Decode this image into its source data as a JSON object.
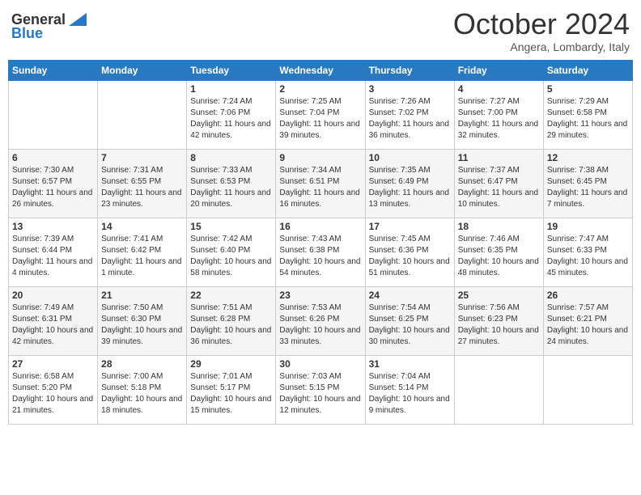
{
  "header": {
    "logo_general": "General",
    "logo_blue": "Blue",
    "month_title": "October 2024",
    "location": "Angera, Lombardy, Italy"
  },
  "days_of_week": [
    "Sunday",
    "Monday",
    "Tuesday",
    "Wednesday",
    "Thursday",
    "Friday",
    "Saturday"
  ],
  "weeks": [
    [
      {
        "day": "",
        "info": ""
      },
      {
        "day": "",
        "info": ""
      },
      {
        "day": "1",
        "info": "Sunrise: 7:24 AM\nSunset: 7:06 PM\nDaylight: 11 hours and 42 minutes."
      },
      {
        "day": "2",
        "info": "Sunrise: 7:25 AM\nSunset: 7:04 PM\nDaylight: 11 hours and 39 minutes."
      },
      {
        "day": "3",
        "info": "Sunrise: 7:26 AM\nSunset: 7:02 PM\nDaylight: 11 hours and 36 minutes."
      },
      {
        "day": "4",
        "info": "Sunrise: 7:27 AM\nSunset: 7:00 PM\nDaylight: 11 hours and 32 minutes."
      },
      {
        "day": "5",
        "info": "Sunrise: 7:29 AM\nSunset: 6:58 PM\nDaylight: 11 hours and 29 minutes."
      }
    ],
    [
      {
        "day": "6",
        "info": "Sunrise: 7:30 AM\nSunset: 6:57 PM\nDaylight: 11 hours and 26 minutes."
      },
      {
        "day": "7",
        "info": "Sunrise: 7:31 AM\nSunset: 6:55 PM\nDaylight: 11 hours and 23 minutes."
      },
      {
        "day": "8",
        "info": "Sunrise: 7:33 AM\nSunset: 6:53 PM\nDaylight: 11 hours and 20 minutes."
      },
      {
        "day": "9",
        "info": "Sunrise: 7:34 AM\nSunset: 6:51 PM\nDaylight: 11 hours and 16 minutes."
      },
      {
        "day": "10",
        "info": "Sunrise: 7:35 AM\nSunset: 6:49 PM\nDaylight: 11 hours and 13 minutes."
      },
      {
        "day": "11",
        "info": "Sunrise: 7:37 AM\nSunset: 6:47 PM\nDaylight: 11 hours and 10 minutes."
      },
      {
        "day": "12",
        "info": "Sunrise: 7:38 AM\nSunset: 6:45 PM\nDaylight: 11 hours and 7 minutes."
      }
    ],
    [
      {
        "day": "13",
        "info": "Sunrise: 7:39 AM\nSunset: 6:44 PM\nDaylight: 11 hours and 4 minutes."
      },
      {
        "day": "14",
        "info": "Sunrise: 7:41 AM\nSunset: 6:42 PM\nDaylight: 11 hours and 1 minute."
      },
      {
        "day": "15",
        "info": "Sunrise: 7:42 AM\nSunset: 6:40 PM\nDaylight: 10 hours and 58 minutes."
      },
      {
        "day": "16",
        "info": "Sunrise: 7:43 AM\nSunset: 6:38 PM\nDaylight: 10 hours and 54 minutes."
      },
      {
        "day": "17",
        "info": "Sunrise: 7:45 AM\nSunset: 6:36 PM\nDaylight: 10 hours and 51 minutes."
      },
      {
        "day": "18",
        "info": "Sunrise: 7:46 AM\nSunset: 6:35 PM\nDaylight: 10 hours and 48 minutes."
      },
      {
        "day": "19",
        "info": "Sunrise: 7:47 AM\nSunset: 6:33 PM\nDaylight: 10 hours and 45 minutes."
      }
    ],
    [
      {
        "day": "20",
        "info": "Sunrise: 7:49 AM\nSunset: 6:31 PM\nDaylight: 10 hours and 42 minutes."
      },
      {
        "day": "21",
        "info": "Sunrise: 7:50 AM\nSunset: 6:30 PM\nDaylight: 10 hours and 39 minutes."
      },
      {
        "day": "22",
        "info": "Sunrise: 7:51 AM\nSunset: 6:28 PM\nDaylight: 10 hours and 36 minutes."
      },
      {
        "day": "23",
        "info": "Sunrise: 7:53 AM\nSunset: 6:26 PM\nDaylight: 10 hours and 33 minutes."
      },
      {
        "day": "24",
        "info": "Sunrise: 7:54 AM\nSunset: 6:25 PM\nDaylight: 10 hours and 30 minutes."
      },
      {
        "day": "25",
        "info": "Sunrise: 7:56 AM\nSunset: 6:23 PM\nDaylight: 10 hours and 27 minutes."
      },
      {
        "day": "26",
        "info": "Sunrise: 7:57 AM\nSunset: 6:21 PM\nDaylight: 10 hours and 24 minutes."
      }
    ],
    [
      {
        "day": "27",
        "info": "Sunrise: 6:58 AM\nSunset: 5:20 PM\nDaylight: 10 hours and 21 minutes."
      },
      {
        "day": "28",
        "info": "Sunrise: 7:00 AM\nSunset: 5:18 PM\nDaylight: 10 hours and 18 minutes."
      },
      {
        "day": "29",
        "info": "Sunrise: 7:01 AM\nSunset: 5:17 PM\nDaylight: 10 hours and 15 minutes."
      },
      {
        "day": "30",
        "info": "Sunrise: 7:03 AM\nSunset: 5:15 PM\nDaylight: 10 hours and 12 minutes."
      },
      {
        "day": "31",
        "info": "Sunrise: 7:04 AM\nSunset: 5:14 PM\nDaylight: 10 hours and 9 minutes."
      },
      {
        "day": "",
        "info": ""
      },
      {
        "day": "",
        "info": ""
      }
    ]
  ]
}
